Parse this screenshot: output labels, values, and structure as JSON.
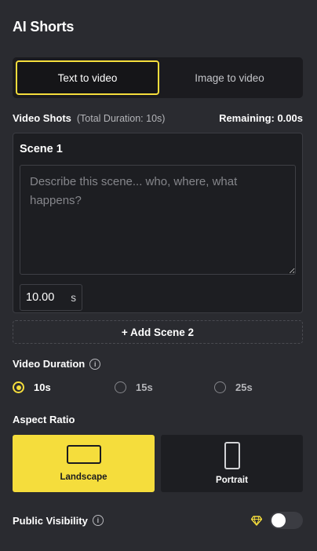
{
  "app": {
    "title": "AI Shorts"
  },
  "mode_tabs": [
    {
      "label": "Text to video",
      "active": true
    },
    {
      "label": "Image to video",
      "active": false
    }
  ],
  "shots": {
    "title": "Video Shots",
    "total_duration": "(Total Duration: 10s)",
    "remaining": "Remaining: 0.00s"
  },
  "scene": {
    "title": "Scene 1",
    "placeholder": "Describe this scene... who, where, what happens?",
    "duration_value": "10.00",
    "duration_unit": "s"
  },
  "add_scene_label": "+ Add Scene 2",
  "video_duration": {
    "label": "Video Duration",
    "options": [
      {
        "label": "10s",
        "selected": true
      },
      {
        "label": "15s",
        "selected": false
      },
      {
        "label": "25s",
        "selected": false
      }
    ]
  },
  "aspect_ratio": {
    "label": "Aspect Ratio",
    "options": [
      {
        "label": "Landscape",
        "selected": true
      },
      {
        "label": "Portrait",
        "selected": false
      }
    ]
  },
  "public_visibility": {
    "label": "Public Visibility",
    "enabled": false
  },
  "colors": {
    "accent": "#f5dd3c",
    "background": "#2a2b30",
    "card": "#1d1e22"
  },
  "icons": {
    "info": "info-icon",
    "diamond": "diamond-icon"
  }
}
